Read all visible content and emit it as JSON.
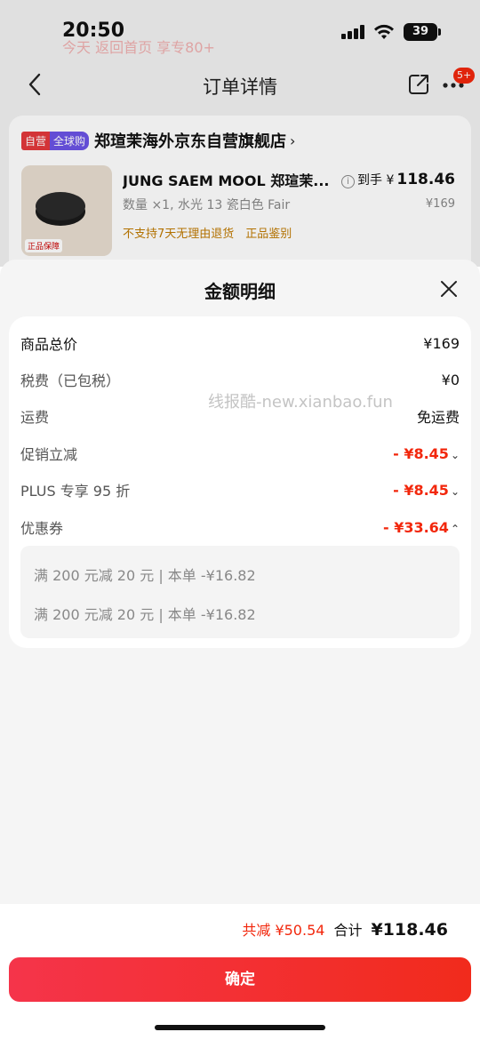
{
  "status_bar": {
    "time": "20:50",
    "battery": "39",
    "ghost_text": "今天 返回首页 享专80+"
  },
  "nav": {
    "title": "订单详情",
    "badge": "5+"
  },
  "store": {
    "tag_self": "自营",
    "tag_global": "全球购",
    "name": "郑瑄茉海外京东自营旗舰店",
    "product_title": "JUNG SAEM MOOL 郑瑄茉...",
    "spec": "数量 ×1, 水光 13 瓷白色 Fair",
    "notes": "不支持7天无理由退货　正品鉴别",
    "price_prefix": "到手 ¥",
    "price_amount": "118.46",
    "price_original": "¥169",
    "image_tag": "正品保障"
  },
  "sheet": {
    "title": "金额明细",
    "rows": [
      {
        "label": "商品总价",
        "value": "¥169"
      },
      {
        "label": "税费（已包税）",
        "value": "¥0"
      },
      {
        "label": "运费",
        "value": "免运费"
      },
      {
        "label": "促销立减",
        "value": "- ¥8.45"
      },
      {
        "label": "PLUS 专享 95 折",
        "value": "- ¥8.45"
      },
      {
        "label": "优惠券",
        "value": "- ¥33.64"
      }
    ],
    "coupons": [
      "满 200 元减 20 元 | 本单 -¥16.82",
      "满 200 元减 20 元 | 本单 -¥16.82"
    ]
  },
  "watermark": "线报酷-new.xianbao.fun",
  "summary": {
    "saved": "共减 ¥50.54",
    "total_label": "合计",
    "total_amount": "¥118.46"
  },
  "confirm_label": "确定",
  "colors": {
    "accent": "#f2270c",
    "button": "#f5344a"
  }
}
